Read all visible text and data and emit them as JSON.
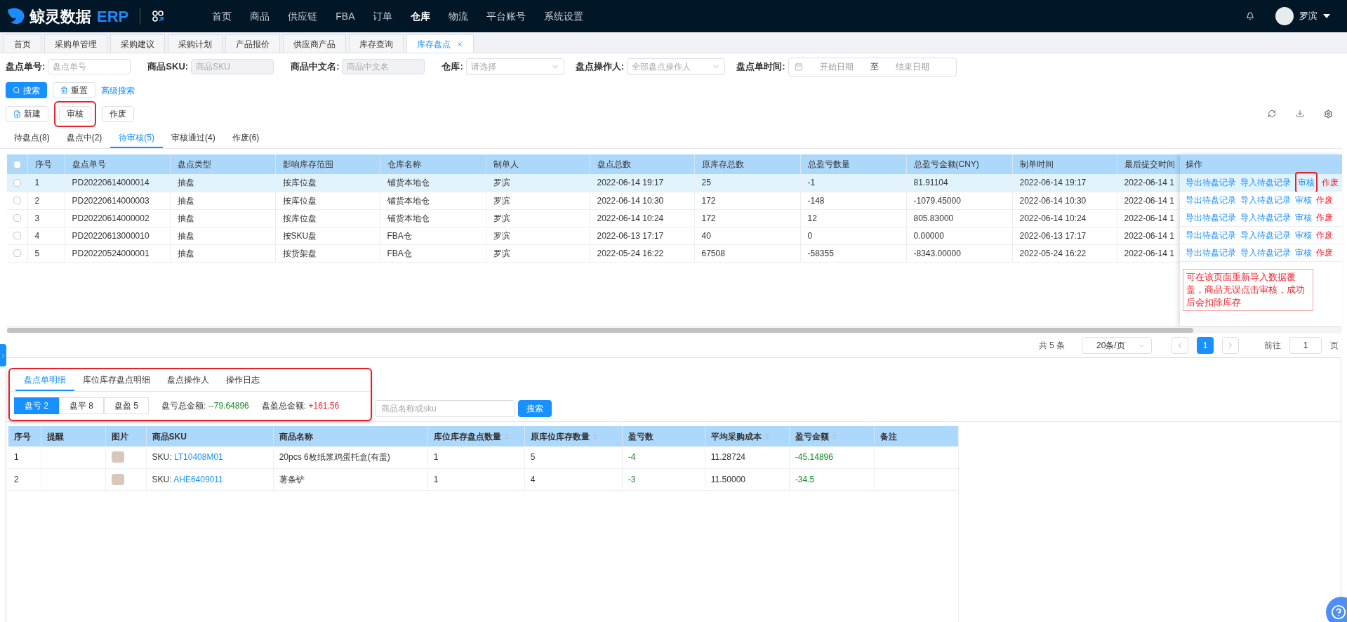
{
  "header": {
    "logo_text": "鲸灵数据",
    "logo_badge": "ERP",
    "nav": [
      {
        "label": "首页",
        "selected": false
      },
      {
        "label": "商品",
        "selected": false
      },
      {
        "label": "供应链",
        "selected": false
      },
      {
        "label": "FBA",
        "selected": false
      },
      {
        "label": "订单",
        "selected": false
      },
      {
        "label": "仓库",
        "selected": true
      },
      {
        "label": "物流",
        "selected": false
      },
      {
        "label": "平台账号",
        "selected": false
      },
      {
        "label": "系统设置",
        "selected": false
      }
    ],
    "user": {
      "name": "罗滨"
    }
  },
  "page_tabs": [
    {
      "label": "首页",
      "selected": false,
      "closable": false
    },
    {
      "label": "采购单管理",
      "selected": false,
      "closable": false
    },
    {
      "label": "采购建议",
      "selected": false,
      "closable": false
    },
    {
      "label": "采购计划",
      "selected": false,
      "closable": false
    },
    {
      "label": "产品报价",
      "selected": false,
      "closable": false
    },
    {
      "label": "供应商产品",
      "selected": false,
      "closable": false
    },
    {
      "label": "库存查询",
      "selected": false,
      "closable": false
    },
    {
      "label": "库存盘点",
      "selected": true,
      "closable": true
    }
  ],
  "filters": [
    {
      "kind": "input",
      "label": "盘点单号:",
      "placeholder": "盘点单号",
      "disabled": false
    },
    {
      "kind": "input",
      "label": "商品SKU:",
      "placeholder": "商品SKU",
      "disabled": true
    },
    {
      "kind": "input",
      "label": "商品中文名:",
      "placeholder": "商品中文名",
      "disabled": true
    },
    {
      "kind": "select",
      "label": "仓库:",
      "placeholder": "请选择",
      "disabled": false
    },
    {
      "kind": "select",
      "label": "盘点操作人:",
      "placeholder": "全部盘点操作人",
      "disabled": false
    },
    {
      "kind": "daterange",
      "label": "盘点单时间:",
      "start_placeholder": "开始日期",
      "separator": "至",
      "end_placeholder": "结束日期",
      "disabled": false
    }
  ],
  "search_buttons": {
    "search": "搜索",
    "reset": "重置",
    "advanced": "高级搜索"
  },
  "actions": [
    {
      "kind": "new",
      "label": "新建",
      "highlighted": false
    },
    {
      "kind": "plain",
      "label": "审核",
      "highlighted": true
    },
    {
      "kind": "plain",
      "label": "作废",
      "highlighted": false
    }
  ],
  "status_tabs": [
    {
      "label": "待盘点(8)",
      "selected": false
    },
    {
      "label": "盘点中(2)",
      "selected": false
    },
    {
      "label": "待审核(5)",
      "selected": true
    },
    {
      "label": "审核通过(4)",
      "selected": false
    },
    {
      "label": "作废(6)",
      "selected": false
    }
  ],
  "table": {
    "all_checked": false,
    "columns": [
      "序号",
      "盘点单号",
      "盘点类型",
      "影响库存范围",
      "仓库名称",
      "制单人",
      "盘点总数",
      "原库存总数",
      "总盈亏数量",
      "总盈亏金额(CNY)",
      "制单时间",
      "最后提交时间"
    ],
    "action_column": "操作",
    "rows": [
      {
        "selected": true,
        "checked": false,
        "cells": [
          "1",
          "PD20220614000014",
          "抽盘",
          "按库位盘",
          "铺货本地仓",
          "罗滨",
          "2022-06-14 19:17",
          "25",
          "-1",
          "81.91104",
          "2022-06-14 19:17",
          "2022-06-14 1"
        ],
        "actions": [
          {
            "kind": "link",
            "label": "导出待盘记录",
            "highlighted": false
          },
          {
            "kind": "link",
            "label": "导入待盘记录",
            "highlighted": false
          },
          {
            "kind": "link",
            "label": "审核",
            "highlighted": true
          },
          {
            "kind": "danger",
            "label": "作废",
            "highlighted": false
          }
        ]
      },
      {
        "selected": false,
        "checked": false,
        "cells": [
          "2",
          "PD20220614000003",
          "抽盘",
          "按库位盘",
          "铺货本地仓",
          "罗滨",
          "2022-06-14 10:30",
          "172",
          "-148",
          "-1079.45000",
          "2022-06-14 10:30",
          "2022-06-14 1"
        ],
        "actions": [
          {
            "kind": "link",
            "label": "导出待盘记录",
            "highlighted": false
          },
          {
            "kind": "link",
            "label": "导入待盘记录",
            "highlighted": false
          },
          {
            "kind": "link",
            "label": "审核",
            "highlighted": false
          },
          {
            "kind": "danger",
            "label": "作废",
            "highlighted": false
          }
        ]
      },
      {
        "selected": false,
        "checked": false,
        "cells": [
          "3",
          "PD20220614000002",
          "抽盘",
          "按库位盘",
          "铺货本地仓",
          "罗滨",
          "2022-06-14 10:24",
          "172",
          "12",
          "805.83000",
          "2022-06-14 10:24",
          "2022-06-14 1"
        ],
        "actions": [
          {
            "kind": "link",
            "label": "导出待盘记录",
            "highlighted": false
          },
          {
            "kind": "link",
            "label": "导入待盘记录",
            "highlighted": false
          },
          {
            "kind": "link",
            "label": "审核",
            "highlighted": false
          },
          {
            "kind": "danger",
            "label": "作废",
            "highlighted": false
          }
        ]
      },
      {
        "selected": false,
        "checked": false,
        "cells": [
          "4",
          "PD20220613000010",
          "抽盘",
          "按SKU盘",
          "FBA仓",
          "罗滨",
          "2022-06-13 17:17",
          "40",
          "0",
          "0.00000",
          "2022-06-13 17:17",
          "2022-06-14 1"
        ],
        "actions": [
          {
            "kind": "link",
            "label": "导出待盘记录",
            "highlighted": false
          },
          {
            "kind": "link",
            "label": "导入待盘记录",
            "highlighted": false
          },
          {
            "kind": "link",
            "label": "审核",
            "highlighted": false
          },
          {
            "kind": "danger",
            "label": "作废",
            "highlighted": false
          }
        ]
      },
      {
        "selected": false,
        "checked": false,
        "cells": [
          "5",
          "PD20220524000001",
          "抽盘",
          "按货架盘",
          "FBA仓",
          "罗滨",
          "2022-05-24 16:22",
          "67508",
          "-58355",
          "-8343.00000",
          "2022-05-24 16:22",
          "2022-06-14 1"
        ],
        "actions": [
          {
            "kind": "link",
            "label": "导出待盘记录",
            "highlighted": false
          },
          {
            "kind": "link",
            "label": "导入待盘记录",
            "highlighted": false
          },
          {
            "kind": "link",
            "label": "审核",
            "highlighted": false
          },
          {
            "kind": "danger",
            "label": "作废",
            "highlighted": false
          }
        ]
      }
    ],
    "note": "可在该页面重新导入数据覆盖，商品无误点击审核，成功后会扣除库存"
  },
  "pagination": {
    "total": "共 5 条",
    "page_size": "20条/页",
    "pages": [
      {
        "label": "1",
        "selected": true
      }
    ],
    "goto_label": "前往",
    "goto_value": "1",
    "page_unit": "页"
  },
  "detail": {
    "highlighted": true,
    "tabs": [
      {
        "label": "盘点单明细",
        "selected": true
      },
      {
        "label": "库位库存盘点明细",
        "selected": false
      },
      {
        "label": "盘点操作人",
        "selected": false
      },
      {
        "label": "操作日志",
        "selected": false
      }
    ],
    "segments": [
      {
        "label": "盘亏 2",
        "selected": true
      },
      {
        "label": "盘平 8",
        "selected": false
      },
      {
        "label": "盘盈 5",
        "selected": false
      }
    ],
    "summaries": [
      {
        "label": "盘亏总金额:",
        "value": "--79.64896",
        "kind": "loss"
      },
      {
        "label": "盘盈总金额:",
        "value": "+161.56",
        "kind": "gain"
      }
    ],
    "search_placeholder": "商品名称或sku",
    "search_button": "搜索",
    "table": {
      "columns": [
        {
          "kind": "index",
          "label": "序号",
          "sortable": false
        },
        {
          "kind": "reminder",
          "label": "提醒",
          "sortable": false
        },
        {
          "kind": "image",
          "label": "图片",
          "sortable": false
        },
        {
          "kind": "sku",
          "label": "商品SKU",
          "sortable": false
        },
        {
          "kind": "name",
          "label": "商品名称",
          "sortable": false
        },
        {
          "kind": "counted",
          "label": "库位库存盘点数量",
          "sortable": true
        },
        {
          "kind": "original",
          "label": "原库位库存数量",
          "sortable": true
        },
        {
          "kind": "diff",
          "label": "盈亏数",
          "sortable": false
        },
        {
          "kind": "cost",
          "label": "平均采购成本",
          "sortable": true
        },
        {
          "kind": "diff_amount",
          "label": "盈亏金额",
          "sortable": true
        },
        {
          "kind": "remark",
          "label": "备注",
          "sortable": false
        }
      ],
      "rows": [
        {
          "index": "1",
          "sku_label": "SKU:",
          "sku": "LT10408M01",
          "name": "20pcs 6枚纸浆鸡蛋托盒(有盖)",
          "counted": "1",
          "original": "5",
          "diff": "-4",
          "cost": "11.28724",
          "diff_amount": "-45.14896",
          "kind": "loss"
        },
        {
          "index": "2",
          "sku_label": "SKU:",
          "sku": "AHE6409011",
          "name": "薯条铲",
          "counted": "1",
          "original": "4",
          "diff": "-3",
          "cost": "11.50000",
          "diff_amount": "-34.5",
          "kind": "loss"
        }
      ]
    }
  }
}
